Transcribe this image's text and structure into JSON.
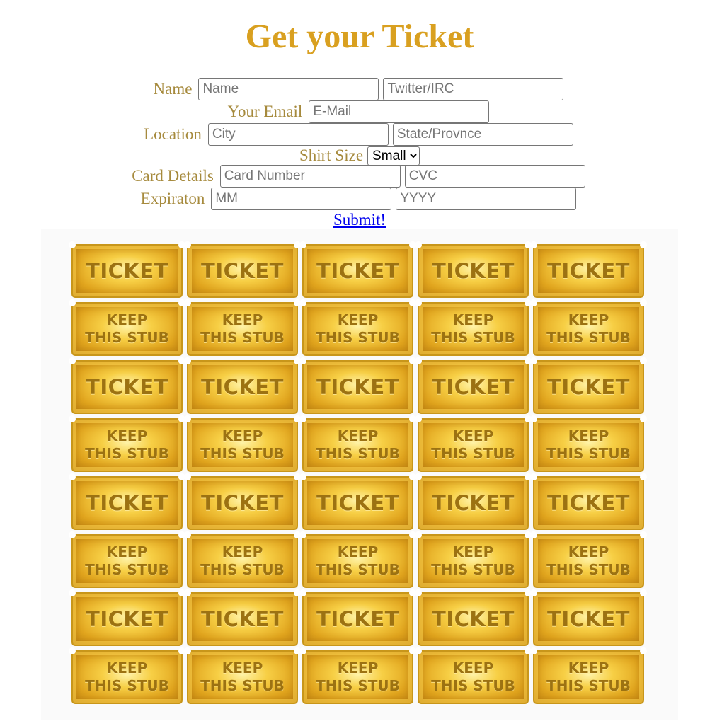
{
  "title": "Get your Ticket",
  "form": {
    "name": {
      "label": "Name",
      "name_placeholder": "Name",
      "handle_placeholder": "Twitter/IRC"
    },
    "email": {
      "label": "Your Email",
      "placeholder": "E-Mail"
    },
    "location": {
      "label": "Location",
      "city_placeholder": "City",
      "state_placeholder": "State/Provnce"
    },
    "shirt": {
      "label": "Shirt Size",
      "selected": "Small"
    },
    "card": {
      "label": "Card Details",
      "number_placeholder": "Card Number",
      "cvc_placeholder": "CVC"
    },
    "expiration": {
      "label": "Expiraton",
      "month_placeholder": "MM",
      "year_placeholder": "YYYY"
    },
    "submit_label": "Submit!"
  },
  "tickets": {
    "ticket_text": "TICKET",
    "stub_line1": "KEEP",
    "stub_line2": "THIS STUB",
    "columns": 5,
    "row_pattern": [
      "ticket",
      "stub",
      "ticket",
      "stub",
      "ticket",
      "stub",
      "ticket",
      "stub"
    ],
    "colors": {
      "gold": "#e1a51e",
      "text": "#9c7212"
    }
  }
}
